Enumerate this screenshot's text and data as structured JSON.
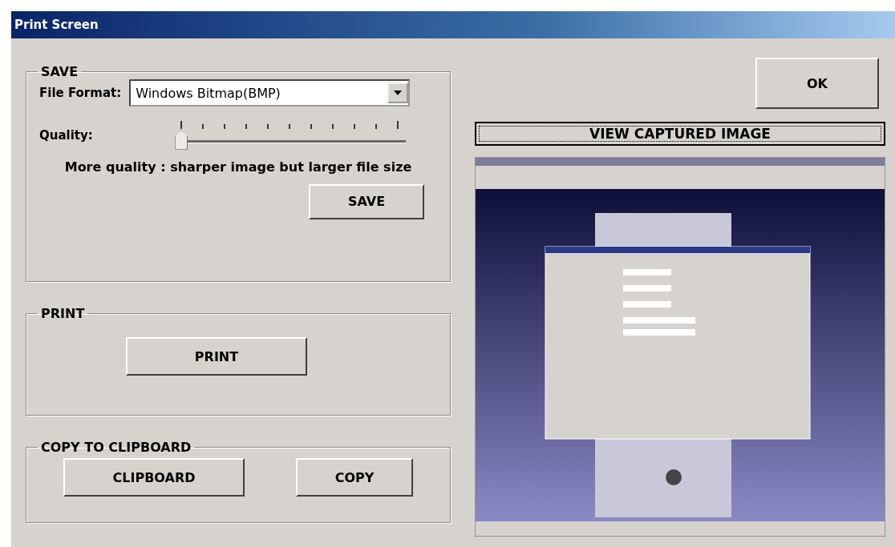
{
  "window": {
    "title": "Print Screen"
  },
  "save": {
    "title": "SAVE",
    "format_label": "File Format:",
    "format_value": "Windows Bitmap(BMP)",
    "quality_label": "Quality:",
    "quality": {
      "level": 0
    },
    "hint": "More quality : sharper image but larger file size",
    "button": "SAVE"
  },
  "print": {
    "title": "PRINT",
    "button": "PRINT"
  },
  "clipboard": {
    "title": "COPY TO CLIPBOARD",
    "buttons": [
      "CLIPBOARD",
      "COPY"
    ]
  },
  "ok_button": "OK",
  "view_button": "VIEW CAPTURED IMAGE"
}
